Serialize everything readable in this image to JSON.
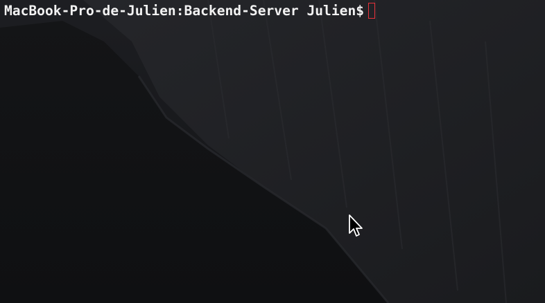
{
  "terminal": {
    "prompt": "MacBook-Pro-de-Julien:Backend-Server Julien$",
    "cursor_color": "#e8323a",
    "text_color": "#f2f2f2",
    "background_color": "#121316"
  },
  "icons": {
    "mouse_pointer": "arrow-pointer-icon",
    "text_cursor": "block-cursor-icon"
  }
}
